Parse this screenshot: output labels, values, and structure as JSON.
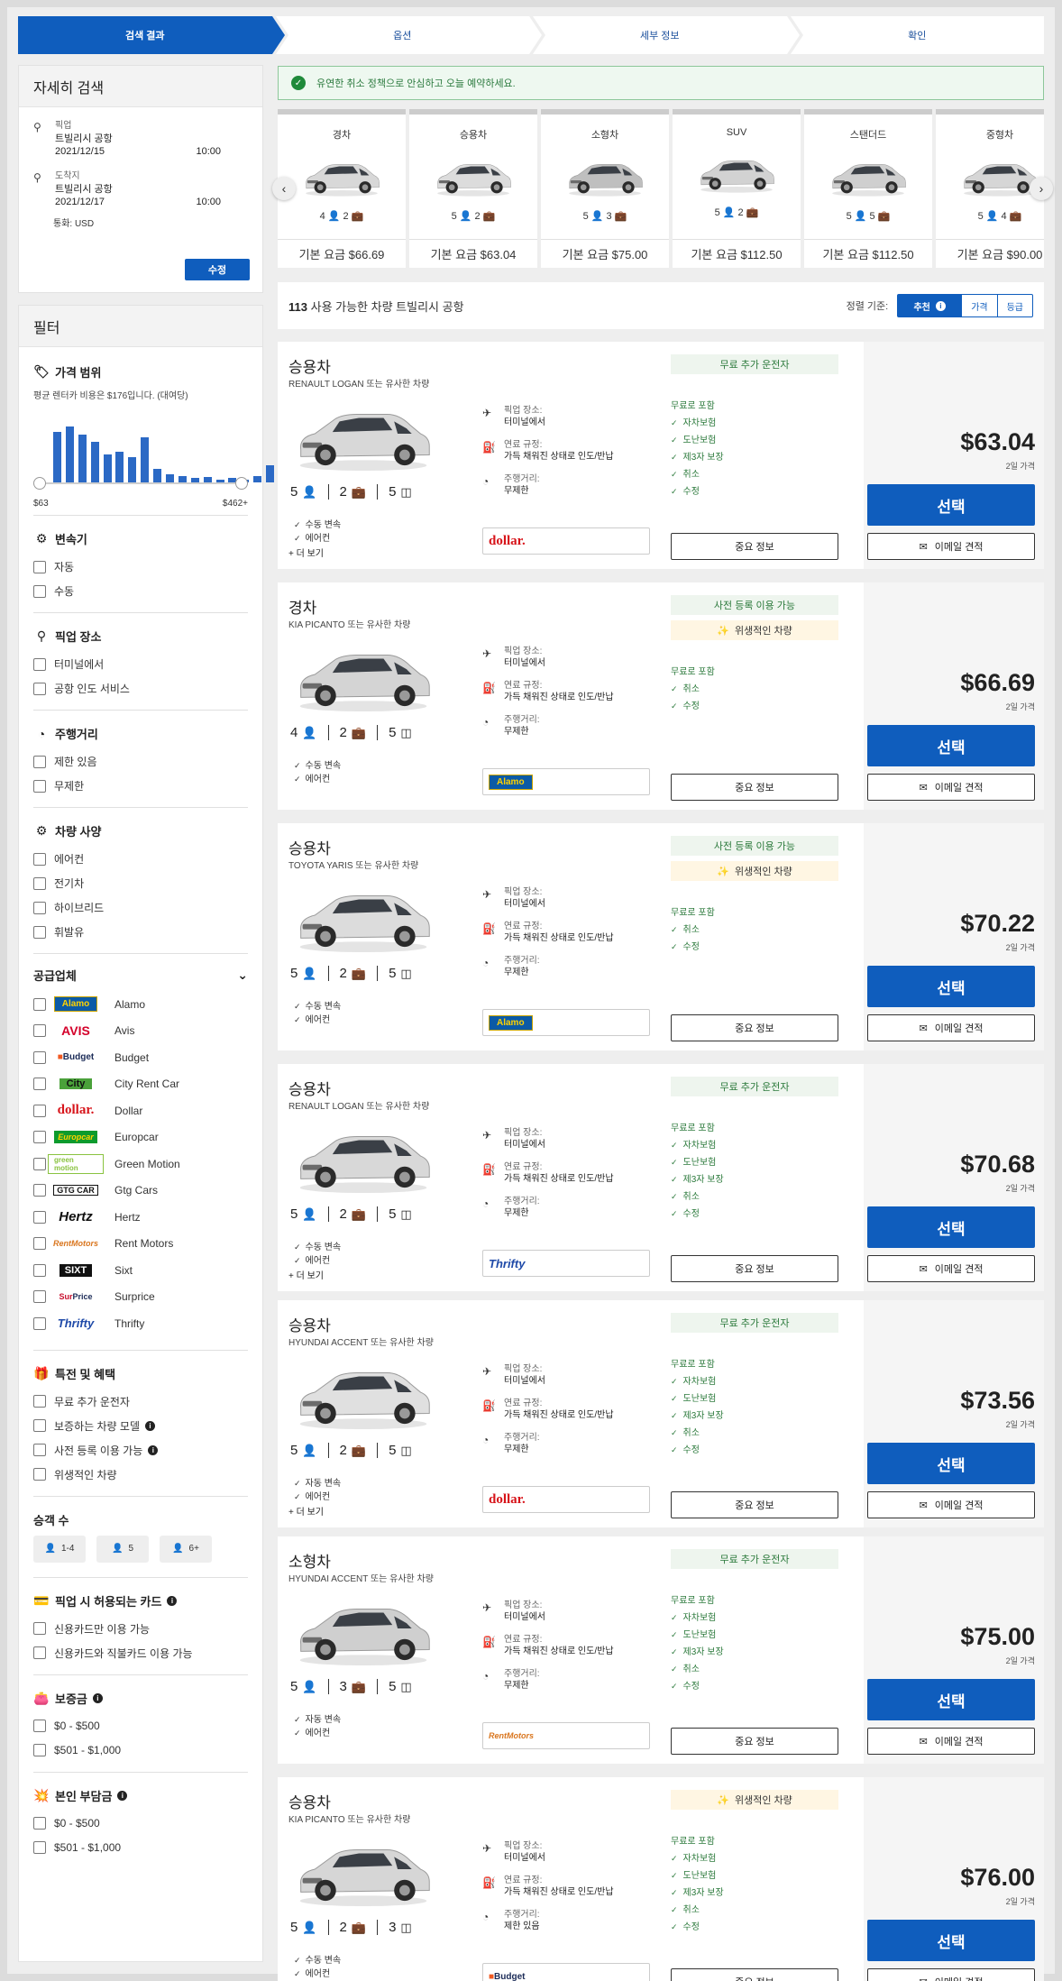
{
  "steps": [
    "검색 결과",
    "옵션",
    "세부 정보",
    "확인"
  ],
  "search": {
    "title": "자세히 검색",
    "pickup_label": "픽업",
    "pickup_location": "트빌리시 공항",
    "pickup_date": "2021/12/15",
    "pickup_time": "10:00",
    "dropoff_label": "도착지",
    "dropoff_location": "트빌리시 공항",
    "dropoff_date": "2021/12/17",
    "dropoff_time": "10:00",
    "currency": "통화: USD",
    "edit_label": "수정"
  },
  "filters": {
    "title": "필터",
    "price": {
      "title": "가격 범위",
      "note": "평균 렌터카 비용은 $176입니다. (대여당)",
      "min": "$63",
      "max": "$462+",
      "histogram": [
        0.9,
        1.0,
        0.85,
        0.72,
        0.5,
        0.55,
        0.45,
        0.8,
        0.25,
        0.15,
        0.12,
        0.08,
        0.1,
        0.05,
        0.08,
        0.05,
        0.12,
        0.3
      ]
    },
    "transmission": {
      "title": "변속기",
      "options": [
        "자동",
        "수동"
      ]
    },
    "pickup": {
      "title": "픽업 장소",
      "options": [
        "터미널에서",
        "공항 인도 서비스"
      ]
    },
    "mileage": {
      "title": "주행거리",
      "options": [
        "제한 있음",
        "무제한"
      ]
    },
    "specs": {
      "title": "차량 사양",
      "options": [
        "에어컨",
        "전기차",
        "하이브리드",
        "휘발유"
      ]
    },
    "suppliers": {
      "title": "공급업체",
      "items": [
        {
          "name": "Alamo",
          "logo": "Alamo"
        },
        {
          "name": "Avis",
          "logo": "AVIS"
        },
        {
          "name": "Budget",
          "logo": "Budget"
        },
        {
          "name": "City Rent Car",
          "logo": "City"
        },
        {
          "name": "Dollar",
          "logo": "dollar."
        },
        {
          "name": "Europcar",
          "logo": "Europcar"
        },
        {
          "name": "Green Motion",
          "logo": "green motion"
        },
        {
          "name": "Gtg Cars",
          "logo": "GTG CAR"
        },
        {
          "name": "Hertz",
          "logo": "Hertz"
        },
        {
          "name": "Rent Motors",
          "logo": "RentMotors"
        },
        {
          "name": "Sixt",
          "logo": "SIXT"
        },
        {
          "name": "Surprice",
          "logo": "SurPrice"
        },
        {
          "name": "Thrifty",
          "logo": "Thrifty"
        }
      ]
    },
    "deals": {
      "title": "특전 및 혜택",
      "options": [
        "무료 추가 운전자",
        "보증하는 차량 모델",
        "사전 등록 이용 가능",
        "위생적인 차량"
      ]
    },
    "passengers": {
      "title": "승객 수",
      "options": [
        "1-4",
        "5",
        "6+"
      ]
    },
    "cards": {
      "title": "픽업 시 허용되는 카드",
      "options": [
        "신용카드만 이용 가능",
        "신용카드와 직불카드 이용 가능"
      ]
    },
    "deposit": {
      "title": "보증금",
      "options": [
        "$0 - $500",
        "$501 - $1,000"
      ]
    },
    "excess": {
      "title": "본인 부담금",
      "options": [
        "$0 - $500",
        "$501 - $1,000"
      ]
    }
  },
  "notice": "유연한 취소 정책으로 안심하고 오늘 예약하세요.",
  "categories": [
    {
      "name": "경차",
      "seats": "4",
      "bags": "2",
      "base": "기본 요금 $66.69"
    },
    {
      "name": "승용차",
      "seats": "5",
      "bags": "2",
      "base": "기본 요금 $63.04"
    },
    {
      "name": "소형차",
      "seats": "5",
      "bags": "3",
      "base": "기본 요금 $75.00"
    },
    {
      "name": "SUV",
      "seats": "5",
      "bags": "2",
      "base": "기본 요금 $112.50"
    },
    {
      "name": "스탠더드",
      "seats": "5",
      "bags": "5",
      "base": "기본 요금 $112.50"
    },
    {
      "name": "중형차",
      "seats": "5",
      "bags": "4",
      "base": "기본 요금 $90.00"
    }
  ],
  "results": {
    "count": "113",
    "text": "사용 가능한 차량 트빌리시 공항",
    "sort_label": "정렬 기준:",
    "sort_options": [
      "추천",
      "가격",
      "등급"
    ]
  },
  "labels": {
    "pickup": "픽업 장소:",
    "fuel": "연료 규정:",
    "mileage": "주행거리:",
    "included": "무료로 포함",
    "important": "중요 정보",
    "select": "선택",
    "email": "이메일 견적",
    "per": "2일 가격",
    "more": "+ 더 보기"
  },
  "cars": [
    {
      "title": "승용차",
      "model": "RENAULT LOGAN 또는 유사한 차량",
      "seats": "5",
      "bags": "2",
      "doors": "5",
      "features": [
        "수동 변속",
        "에어컨"
      ],
      "more": true,
      "pickup": "터미널에서",
      "fuel": "가득 채워진 상태로 인도/반납",
      "mileage": "무제한",
      "vendor": "dollar.",
      "badges": [
        {
          "t": "무료 추가 운전자",
          "c": "g"
        }
      ],
      "included": [
        "자차보험",
        "도난보험",
        "제3자 보장",
        "취소",
        "수정"
      ],
      "price": "$63.04",
      "color": "#d8d8d8"
    },
    {
      "title": "경차",
      "model": "KIA PICANTO 또는 유사한 차량",
      "seats": "4",
      "bags": "2",
      "doors": "5",
      "features": [
        "수동 변속",
        "에어컨"
      ],
      "more": false,
      "pickup": "터미널에서",
      "fuel": "가득 채워진 상태로 인도/반납",
      "mileage": "무제한",
      "vendor": "Alamo",
      "badges": [
        {
          "t": "사전 등록 이용 가능",
          "c": "g"
        },
        {
          "t": "위생적인 차량",
          "c": "y"
        }
      ],
      "included": [
        "취소",
        "수정"
      ],
      "price": "$66.69",
      "color": "#d4d4d4"
    },
    {
      "title": "승용차",
      "model": "TOYOTA YARIS 또는 유사한 차량",
      "seats": "5",
      "bags": "2",
      "doors": "5",
      "features": [
        "수동 변속",
        "에어컨"
      ],
      "more": false,
      "pickup": "터미널에서",
      "fuel": "가득 채워진 상태로 인도/반납",
      "mileage": "무제한",
      "vendor": "Alamo",
      "badges": [
        {
          "t": "사전 등록 이용 가능",
          "c": "g"
        },
        {
          "t": "위생적인 차량",
          "c": "y"
        }
      ],
      "included": [
        "취소",
        "수정"
      ],
      "price": "$70.22",
      "color": "#dcdcdc"
    },
    {
      "title": "승용차",
      "model": "RENAULT LOGAN 또는 유사한 차량",
      "seats": "5",
      "bags": "2",
      "doors": "5",
      "features": [
        "수동 변속",
        "에어컨"
      ],
      "more": true,
      "pickup": "터미널에서",
      "fuel": "가득 채워진 상태로 인도/반납",
      "mileage": "무제한",
      "vendor": "Thrifty",
      "badges": [
        {
          "t": "무료 추가 운전자",
          "c": "g"
        }
      ],
      "included": [
        "자차보험",
        "도난보험",
        "제3자 보장",
        "취소",
        "수정"
      ],
      "price": "$70.68",
      "color": "#d8d8d8"
    },
    {
      "title": "승용차",
      "model": "HYUNDAI ACCENT 또는 유사한 차량",
      "seats": "5",
      "bags": "2",
      "doors": "5",
      "features": [
        "자동 변속",
        "에어컨"
      ],
      "more": true,
      "pickup": "터미널에서",
      "fuel": "가득 채워진 상태로 인도/반납",
      "mileage": "무제한",
      "vendor": "dollar.",
      "badges": [
        {
          "t": "무료 추가 운전자",
          "c": "g"
        }
      ],
      "included": [
        "자차보험",
        "도난보험",
        "제3자 보장",
        "취소",
        "수정"
      ],
      "price": "$73.56",
      "color": "#e0e0e0"
    },
    {
      "title": "소형차",
      "model": "HYUNDAI ACCENT 또는 유사한 차량",
      "seats": "5",
      "bags": "3",
      "doors": "5",
      "features": [
        "자동 변속",
        "에어컨"
      ],
      "more": false,
      "pickup": "터미널에서",
      "fuel": "가득 채워진 상태로 인도/반납",
      "mileage": "무제한",
      "vendor": "RentMotors",
      "badges": [
        {
          "t": "무료 추가 운전자",
          "c": "g"
        }
      ],
      "included": [
        "자차보험",
        "도난보험",
        "제3자 보장",
        "취소",
        "수정"
      ],
      "price": "$75.00",
      "color": "#cfcfcf"
    },
    {
      "title": "승용차",
      "model": "KIA PICANTO 또는 유사한 차량",
      "seats": "5",
      "bags": "2",
      "doors": "3",
      "features": [
        "수동 변속",
        "에어컨"
      ],
      "more": false,
      "pickup": "터미널에서",
      "fuel": "가득 채워진 상태로 인도/반납",
      "mileage": "제한 있음",
      "vendor": "Budget",
      "badges": [
        {
          "t": "위생적인 차량",
          "c": "y"
        }
      ],
      "included": [
        "자차보험",
        "도난보험",
        "제3자 보장",
        "취소",
        "수정"
      ],
      "price": "$76.00",
      "color": "#d6d6d6"
    }
  ],
  "colors": {
    "primary": "#0f5dbd",
    "success": "#2c7a3c",
    "hist": "#2b69c5"
  },
  "icons": {
    "pin": "map-pin-icon",
    "plane": "plane-icon",
    "fuel": "fuel-icon",
    "gauge": "gauge-icon",
    "person": "person-icon",
    "bag": "suitcase-icon",
    "door": "door-icon",
    "check": "check-icon",
    "mail": "envelope-icon",
    "tag": "price-tag-icon"
  }
}
